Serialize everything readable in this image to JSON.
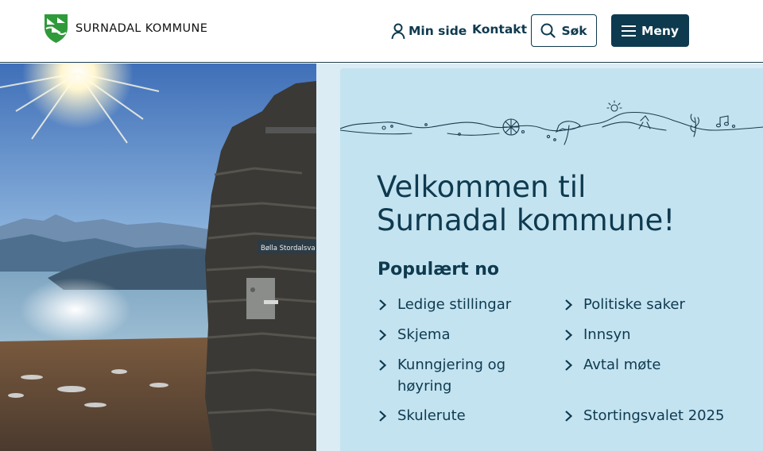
{
  "header": {
    "logo_text": "SURNADAL KOMMUNE",
    "min_side_label": "Min side",
    "kontakt_label": "Kontakt",
    "sok_label": "Søk",
    "meny_label": "Meny"
  },
  "hero": {
    "sign_text": "Bølla Stordalsva"
  },
  "welcome": {
    "title_line1": "Velkommen til",
    "title_line2": "Surnadal kommune!"
  },
  "popular": {
    "title": "Populært no",
    "left": [
      {
        "label": "Ledige stillingar"
      },
      {
        "label": "Skjema"
      },
      {
        "label": "Kunngjering og høyring"
      },
      {
        "label": "Skulerute"
      }
    ],
    "right": [
      {
        "label": "Politiske saker"
      },
      {
        "label": "Innsyn"
      },
      {
        "label": "Avtal møte"
      },
      {
        "label": "Stortingsvalet 2025"
      }
    ]
  },
  "colors": {
    "brand_dark": "#0e3a4f",
    "panel_blue": "#c4e3f0",
    "logo_green": "#2f9a3a"
  },
  "icons": [
    "person-icon",
    "search-icon",
    "hamburger-icon",
    "chevron-right-icon",
    "coat-of-arms-icon"
  ]
}
